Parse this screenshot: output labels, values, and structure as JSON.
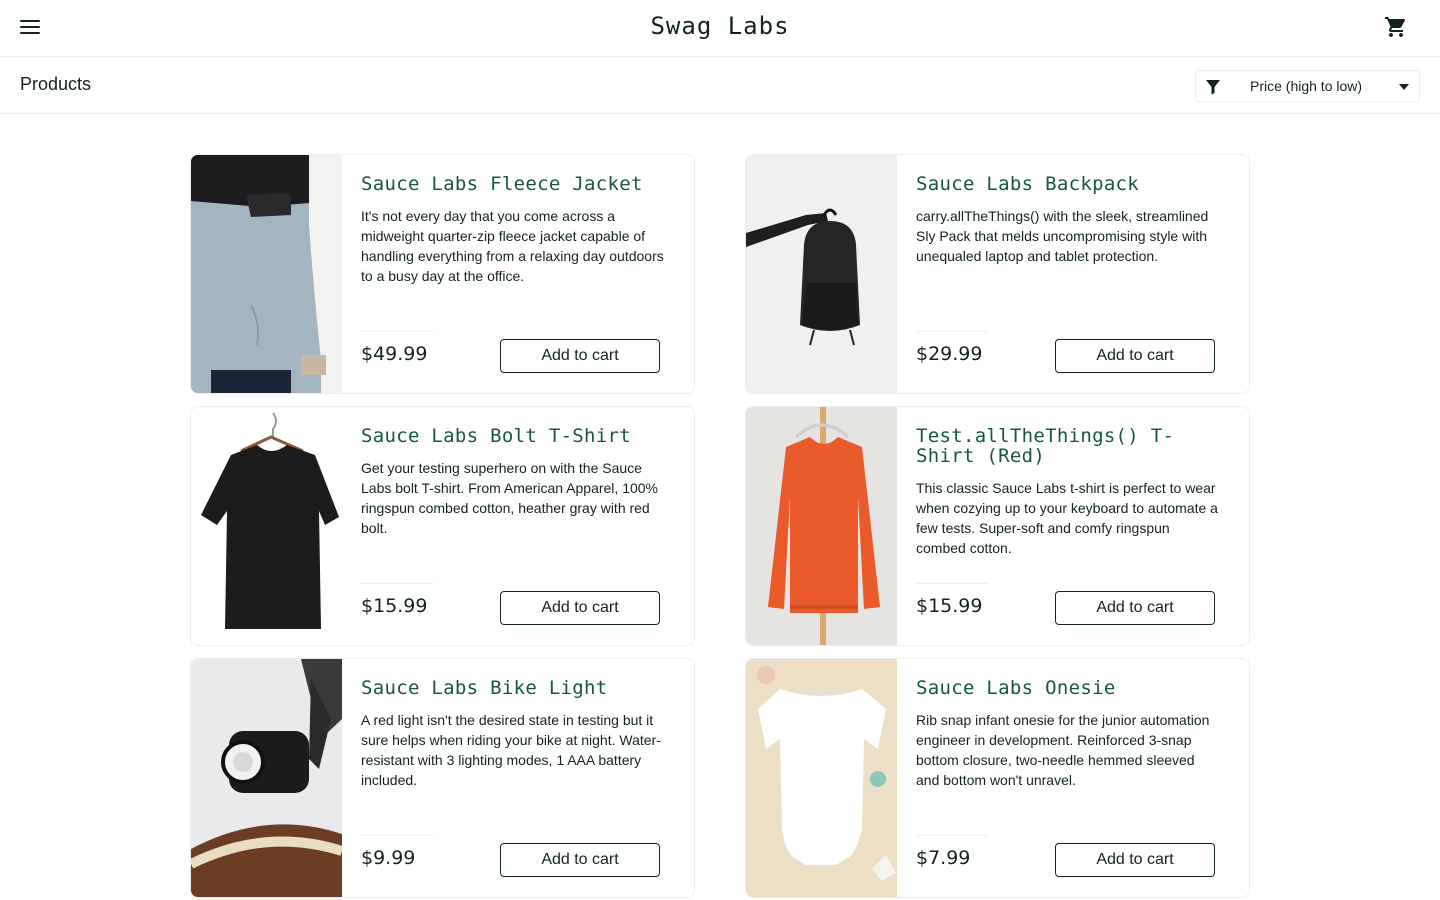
{
  "app": {
    "title": "Swag Labs"
  },
  "header": {
    "menu_icon": "hamburger-menu-icon",
    "cart_icon": "shopping-cart-icon"
  },
  "subheader": {
    "title": "Products",
    "sort": {
      "icon": "filter-icon",
      "selected": "Price (high to low)"
    }
  },
  "products": [
    {
      "name": "Sauce Labs Fleece Jacket",
      "description": "It's not every day that you come across a midweight quarter-zip fleece jacket capable of handling everything from a relaxing day outdoors to a busy day at the office.",
      "price": "$49.99",
      "button": "Add to cart"
    },
    {
      "name": "Sauce Labs Backpack",
      "description": "carry.allTheThings() with the sleek, streamlined Sly Pack that melds uncompromising style with unequaled laptop and tablet protection.",
      "price": "$29.99",
      "button": "Add to cart"
    },
    {
      "name": "Sauce Labs Bolt T-Shirt",
      "description": "Get your testing superhero on with the Sauce Labs bolt T-shirt. From American Apparel, 100% ringspun combed cotton, heather gray with red bolt.",
      "price": "$15.99",
      "button": "Add to cart"
    },
    {
      "name": "Test.allTheThings() T-Shirt (Red)",
      "description": "This classic Sauce Labs t-shirt is perfect to wear when cozying up to your keyboard to automate a few tests. Super-soft and comfy ringspun combed cotton.",
      "price": "$15.99",
      "button": "Add to cart"
    },
    {
      "name": "Sauce Labs Bike Light",
      "description": "A red light isn't the desired state in testing but it sure helps when riding your bike at night. Water-resistant with 3 lighting modes, 1 AAA battery included.",
      "price": "$9.99",
      "button": "Add to cart"
    },
    {
      "name": "Sauce Labs Onesie",
      "description": "Rib snap infant onesie for the junior automation engineer in development. Reinforced 3-snap bottom closure, two-needle hemmed sleeved and bottom won't unravel.",
      "price": "$7.99",
      "button": "Add to cart"
    }
  ]
}
